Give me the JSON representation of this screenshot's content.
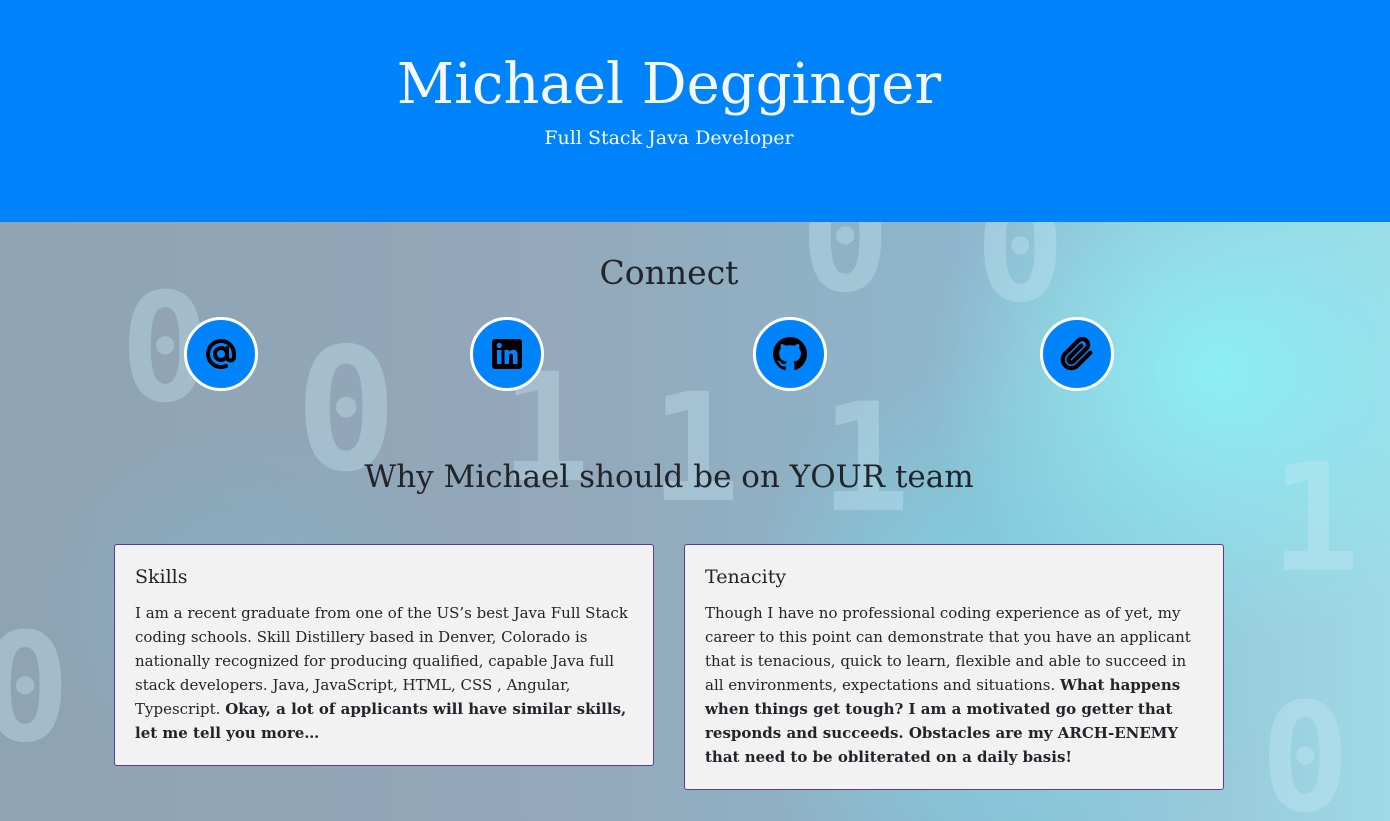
{
  "header": {
    "name": "Michael Degginger",
    "subtitle": "Full Stack Java Developer",
    "background_color": "#0184fb"
  },
  "connect": {
    "title": "Connect",
    "links": [
      {
        "icon": "at-icon",
        "label": "Email"
      },
      {
        "icon": "linkedin-icon",
        "label": "LinkedIn"
      },
      {
        "icon": "github-icon",
        "label": "GitHub"
      },
      {
        "icon": "paperclip-icon",
        "label": "Resume"
      }
    ]
  },
  "why": {
    "title": "Why Michael should be on YOUR team",
    "cards": [
      {
        "title": "Skills",
        "text": "I am a recent graduate from one of the US’s best Java Full Stack coding schools. Skill Distillery based in Denver, Colorado is nationally recognized for producing qualified, capable Java full stack developers. Java, JavaScript, HTML, CSS , Angular, Typescript.",
        "bold": "Okay, a lot of applicants will have similar skills, let me tell you more…"
      },
      {
        "title": "Tenacity",
        "text": "Though I have no professional coding experience as of yet, my career to this point can demonstrate that you have an applicant that is tenacious, quick to learn, flexible and able to succeed in all environments, expectations and situations.",
        "bold": "What happens when things get tough? I am a motivated go getter that responds and succeeds. Obstacles are my ARCH-ENEMY that need to be obliterated on a daily basis!"
      }
    ]
  },
  "colors": {
    "accent": "#0184fb",
    "card_border": "#5b3a9c",
    "card_background": "#f2f2f2"
  }
}
